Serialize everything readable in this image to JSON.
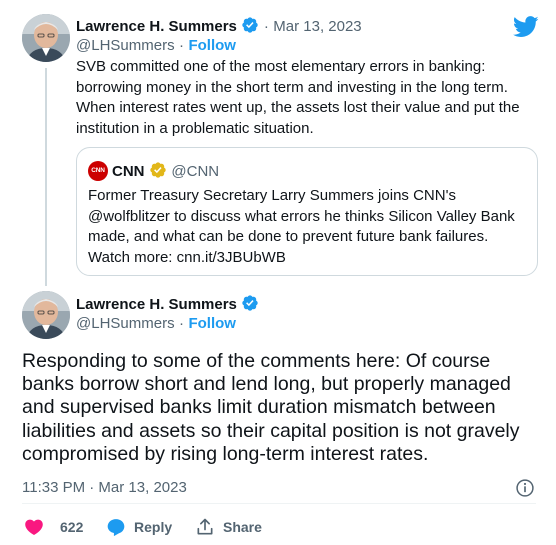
{
  "colors": {
    "accent": "#1d9bf0",
    "verified": "#1d9bf0",
    "cnn_red": "#cc0000",
    "like": "#f91880",
    "muted": "#536471"
  },
  "tweet1": {
    "author_name": "Lawrence H. Summers",
    "separator": "·",
    "date": "Mar 13, 2023",
    "handle": "@LHSummers",
    "follow_label": "Follow",
    "text": "SVB committed one of the most elementary errors in banking: borrowing money in the short term and investing in the long term. When interest rates went up, the assets lost their value and put the institution in a problematic situation.",
    "quote": {
      "logo_text": "CNN",
      "author_name": "CNN",
      "handle": "@CNN",
      "text": "Former Treasury Secretary Larry Summers joins CNN's @wolfblitzer to discuss what errors he thinks Silicon Valley Bank made, and what can be done to prevent future bank failures. Watch more: cnn.it/3JBUbWB"
    }
  },
  "tweet2": {
    "author_name": "Lawrence H. Summers",
    "handle": "@LHSummers",
    "follow_label": "Follow",
    "text": "Responding to some of the comments here: Of course banks borrow short and lend long, but properly managed and supervised banks limit duration mismatch between liabilities and assets so their capital position is not gravely compromised by rising long-term interest rates.",
    "timestamp": "11:33 PM · Mar 13, 2023",
    "actions": {
      "like_count": "622",
      "reply_label": "Reply",
      "share_label": "Share"
    }
  },
  "icons": [
    "twitter-bird-icon",
    "verified-badge-icon",
    "heart-icon",
    "reply-icon",
    "share-icon",
    "info-icon"
  ]
}
